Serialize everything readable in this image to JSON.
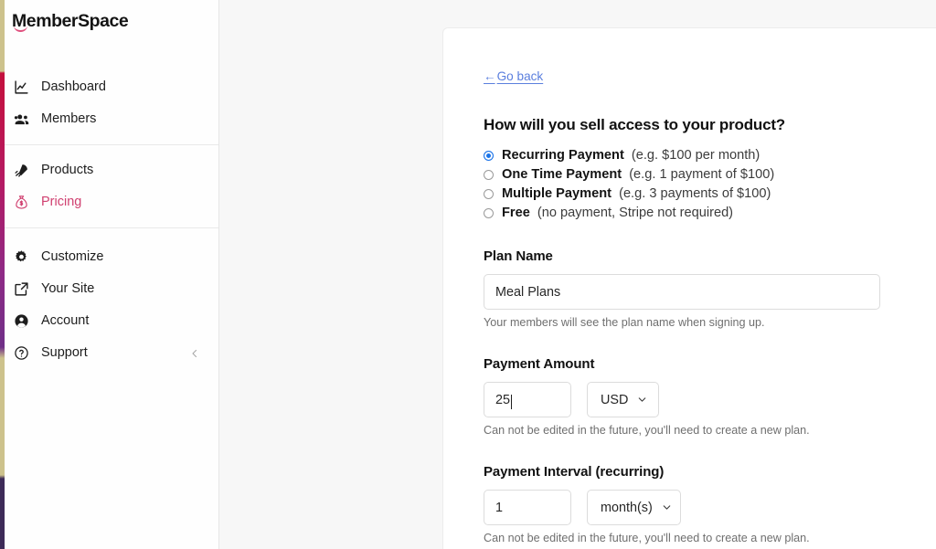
{
  "brand": {
    "logo_text": "MemberSpace",
    "accent_color": "#d04070",
    "link_color": "#5b7fde",
    "radio_selected_color": "#1a73e8"
  },
  "sidebar": {
    "groups": [
      {
        "items": [
          {
            "label": "Dashboard",
            "icon": "chart-line-icon",
            "active": false
          },
          {
            "label": "Members",
            "icon": "people-group-icon",
            "active": false
          }
        ]
      },
      {
        "items": [
          {
            "label": "Products",
            "icon": "rocket-icon",
            "active": false
          },
          {
            "label": "Pricing",
            "icon": "money-bag-icon",
            "active": true
          }
        ]
      },
      {
        "items": [
          {
            "label": "Customize",
            "icon": "gear-icon",
            "active": false
          },
          {
            "label": "Your Site",
            "icon": "external-link-icon",
            "active": false
          },
          {
            "label": "Account",
            "icon": "user-circle-icon",
            "active": false
          },
          {
            "label": "Support",
            "icon": "question-circle-icon",
            "active": false,
            "trailing_icon": "chevron-left-icon"
          }
        ]
      }
    ]
  },
  "main": {
    "go_back": {
      "arrow": "←",
      "label": "Go back"
    },
    "question": "How will you sell access to your product?",
    "payment_options": [
      {
        "name": "Recurring Payment",
        "hint": "(e.g. $100 per month)",
        "selected": true
      },
      {
        "name": "One Time Payment",
        "hint": "(e.g. 1 payment of $100)",
        "selected": false
      },
      {
        "name": "Multiple Payment",
        "hint": "(e.g. 3 payments of $100)",
        "selected": false
      },
      {
        "name": "Free",
        "hint": "(no payment, Stripe not required)",
        "selected": false
      }
    ],
    "plan_name": {
      "label": "Plan Name",
      "value": "Meal Plans",
      "placeholder": "Plan Name",
      "helper": "Your members will see the plan name when signing up."
    },
    "payment_amount": {
      "label": "Payment Amount",
      "value": "25",
      "placeholder": "0",
      "currency": "USD",
      "helper": "Can not be edited in the future, you'll need to create a new plan."
    },
    "payment_interval": {
      "label": "Payment Interval (recurring)",
      "value": "1",
      "placeholder": "1",
      "unit": "month(s)",
      "helper": "Can not be edited in the future, you'll need to create a new plan."
    }
  }
}
